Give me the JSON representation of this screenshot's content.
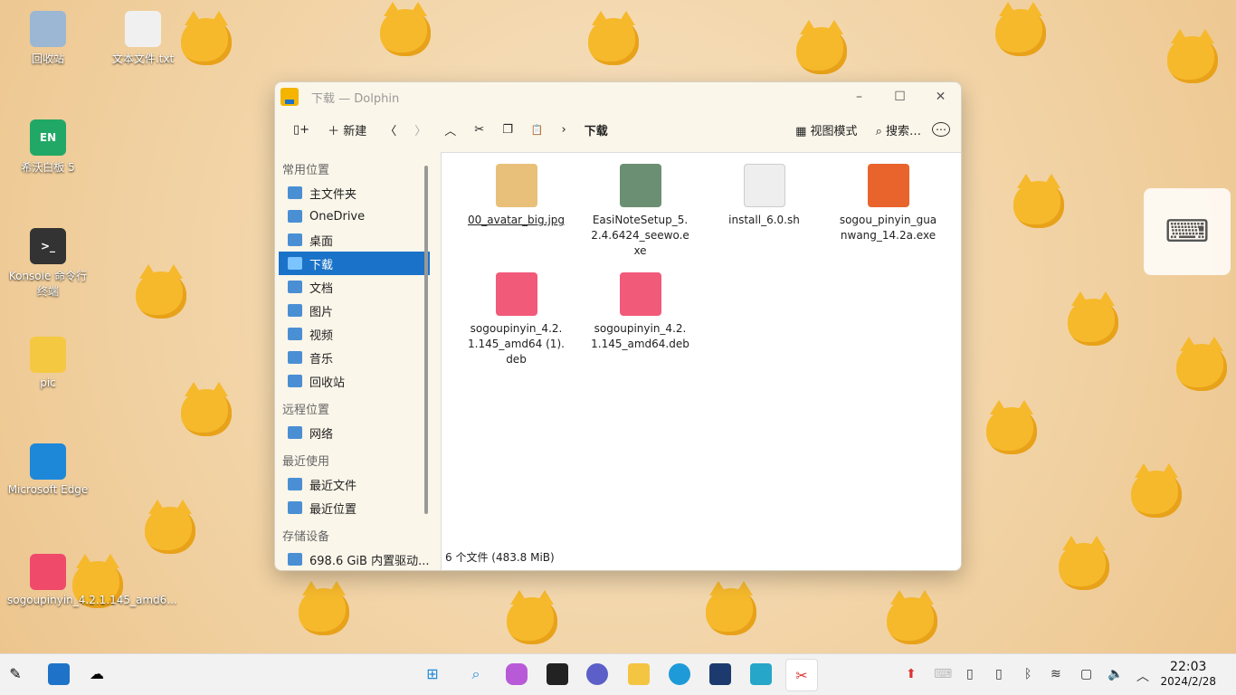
{
  "desktop": {
    "icons": [
      {
        "label": "回收站",
        "color": "#9bb7d4"
      },
      {
        "label": "文本文件.txt",
        "color": "#f0f0f0"
      },
      {
        "label": "希沃白板 5",
        "color": "#22a866",
        "glyph": "EN"
      },
      {
        "label": "Konsole 命令行终端",
        "color": "#333",
        "glyph": ">_"
      },
      {
        "label": "pic",
        "color": "#f5c842"
      },
      {
        "label": "Microsoft Edge",
        "color": "#1e88d8"
      },
      {
        "label": "sogoupinyin_4.2.1.145_amd6...",
        "color": "#f04a6a"
      }
    ]
  },
  "window": {
    "title": "下载 — Dolphin",
    "minimize": "–",
    "maximize": "☐",
    "close": "✕"
  },
  "toolbar": {
    "new_tab": "+",
    "new_label": "新建",
    "back": "〈",
    "forward": "〉",
    "up": "︿",
    "cut": "✂",
    "copy": "❐",
    "paste": "📋",
    "breadcrumb_sep": "›",
    "breadcrumb": "下载",
    "view_label": "视图模式",
    "search_label": "搜索…",
    "menu": "⋯"
  },
  "sidebar": {
    "sections": [
      {
        "title": "常用位置",
        "items": [
          {
            "label": "主文件夹"
          },
          {
            "label": "OneDrive"
          },
          {
            "label": "桌面"
          },
          {
            "label": "下载",
            "selected": true
          },
          {
            "label": "文档"
          },
          {
            "label": "图片"
          },
          {
            "label": "视频"
          },
          {
            "label": "音乐"
          },
          {
            "label": "回收站"
          }
        ]
      },
      {
        "title": "远程位置",
        "items": [
          {
            "label": "网络"
          }
        ]
      },
      {
        "title": "最近使用",
        "items": [
          {
            "label": "最近文件"
          },
          {
            "label": "最近位置"
          }
        ]
      },
      {
        "title": "存储设备",
        "items": [
          {
            "label": "698.6 GiB 内置驱动..."
          }
        ]
      }
    ]
  },
  "files": [
    {
      "name": "00_avatar_big.jpg",
      "color": "#e8c07a"
    },
    {
      "name": "EasiNoteSetup_5.2.4.6424_seewo.exe",
      "color": "#6b8f73"
    },
    {
      "name": "install_6.0.sh",
      "color": "#eeeeee"
    },
    {
      "name": "sogou_pinyin_guanwang_14.2a.exe",
      "color": "#e8642c"
    },
    {
      "name": "sogoupinyin_4.2.1.145_amd64 (1).deb",
      "color": "#f25a7a"
    },
    {
      "name": "sogoupinyin_4.2.1.145_amd64.deb",
      "color": "#f25a7a"
    }
  ],
  "status": "6 个文件 (483.8 MiB)",
  "taskbar": {
    "time": "22:03",
    "date": "2024/2/28"
  }
}
